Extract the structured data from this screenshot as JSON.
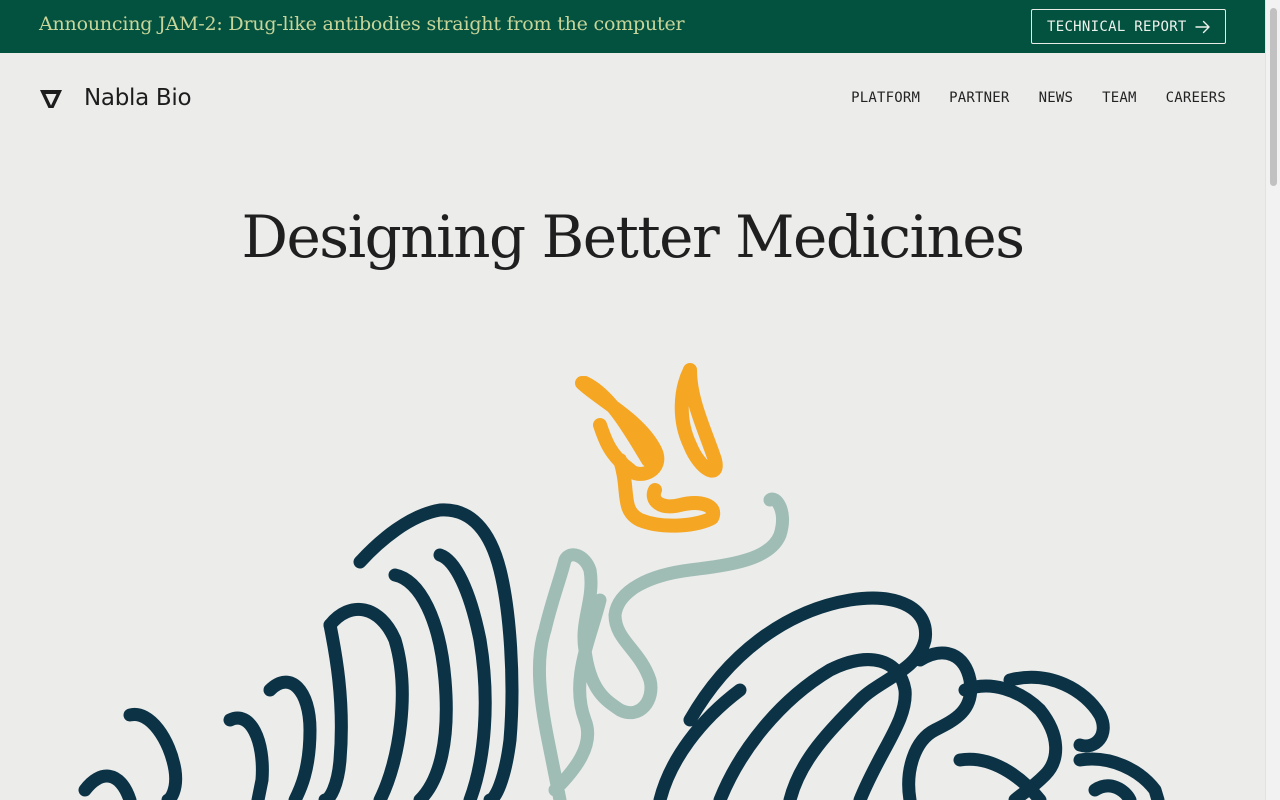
{
  "banner": {
    "text": "Announcing JAM-2: Drug-like antibodies straight from the computer",
    "button_label": "TECHNICAL REPORT",
    "background_color": "#03513f",
    "text_color": "#c7d59a"
  },
  "header": {
    "brand": "Nabla Bio",
    "nav": [
      "PLATFORM",
      "PARTNER",
      "NEWS",
      "TEAM",
      "CAREERS"
    ]
  },
  "hero": {
    "title": "Designing Better Medicines"
  },
  "colors": {
    "dark_strands": "#0b3345",
    "light_strands": "#9fbdb5",
    "accent_strand": "#f5a623"
  }
}
